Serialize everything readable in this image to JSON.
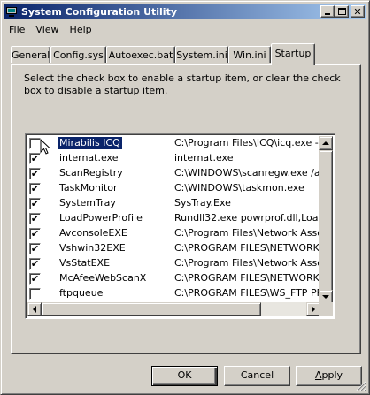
{
  "window": {
    "title": "System Configuration Utility"
  },
  "menu": [
    {
      "label": "File",
      "key": "F",
      "rest": "ile"
    },
    {
      "label": "View",
      "key": "V",
      "rest": "iew"
    },
    {
      "label": "Help",
      "key": "H",
      "rest": "elp"
    }
  ],
  "tabs": [
    "General",
    "Config.sys",
    "Autoexec.bat",
    "System.ini",
    "Win.ini",
    "Startup"
  ],
  "active_tab": "Startup",
  "instruction": "Select the check box to enable a startup item, or clear the check box to disable a startup item.",
  "startup_items": [
    {
      "name": "Mirabilis ICQ",
      "command": "C:\\Program Files\\ICQ\\icq.exe -minimiz",
      "checked": false,
      "selected": true
    },
    {
      "name": "internat.exe",
      "command": "internat.exe",
      "checked": true,
      "selected": false
    },
    {
      "name": "ScanRegistry",
      "command": "C:\\WINDOWS\\scanregw.exe /autoru",
      "checked": true,
      "selected": false
    },
    {
      "name": "TaskMonitor",
      "command": "C:\\WINDOWS\\taskmon.exe",
      "checked": true,
      "selected": false
    },
    {
      "name": "SystemTray",
      "command": "SysTray.Exe",
      "checked": true,
      "selected": false
    },
    {
      "name": "LoadPowerProfile",
      "command": "Rundll32.exe powrprof.dll,LoadCurren",
      "checked": true,
      "selected": false
    },
    {
      "name": "AvconsoleEXE",
      "command": "C:\\Program Files\\Network Associates",
      "checked": true,
      "selected": false
    },
    {
      "name": "Vshwin32EXE",
      "command": "C:\\PROGRAM FILES\\NETWORK AS",
      "checked": true,
      "selected": false
    },
    {
      "name": "VsStatEXE",
      "command": "C:\\Program Files\\Network Associates",
      "checked": true,
      "selected": false
    },
    {
      "name": "McAfeeWebScanX",
      "command": "C:\\PROGRAM FILES\\NETWORK AS",
      "checked": true,
      "selected": false
    },
    {
      "name": "ftpqueue",
      "command": "C:\\PROGRAM FILES\\WS_FTP PRO",
      "checked": false,
      "selected": false
    }
  ],
  "buttons": {
    "ok": "OK",
    "cancel": "Cancel",
    "apply": "Apply",
    "apply_key": "A",
    "apply_rest": "pply"
  },
  "colors": {
    "titlebar_start": "#0a246a",
    "titlebar_end": "#a6caf0",
    "face": "#d4d0c8",
    "selection": "#0a246a"
  },
  "icons": [
    "app-icon",
    "minimize-icon",
    "maximize-icon",
    "close-icon",
    "checkmark-icon",
    "cursor-icon",
    "scroll-up-icon",
    "scroll-down-icon",
    "scroll-left-icon",
    "scroll-right-icon",
    "size-grip-icon"
  ]
}
